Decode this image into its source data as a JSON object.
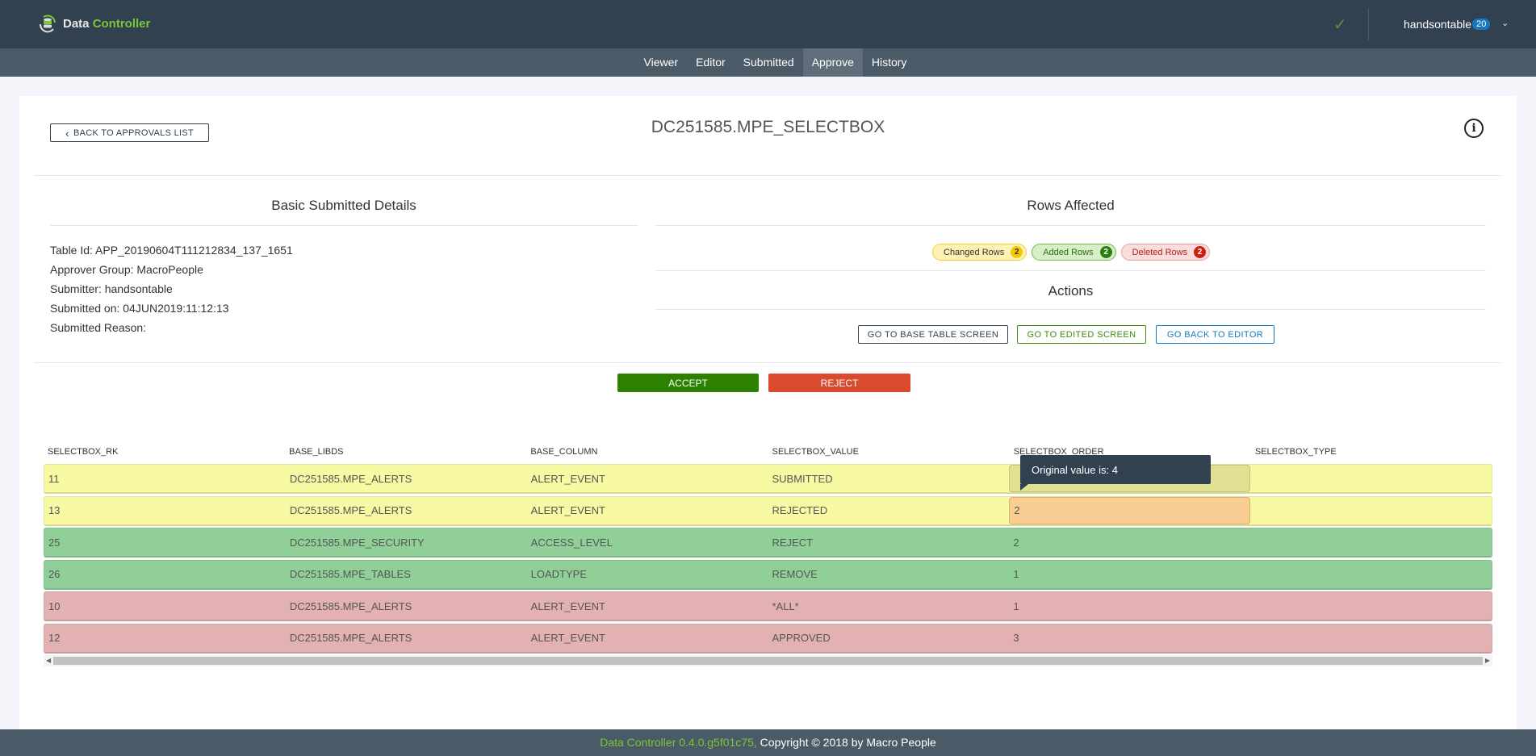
{
  "header": {
    "app_name_part1": "Data",
    "app_name_part2": "Controller",
    "status_icon": "check-icon",
    "user": "handsontable",
    "user_badge": "20"
  },
  "nav": {
    "items": [
      {
        "label": "Viewer",
        "active": false
      },
      {
        "label": "Editor",
        "active": false
      },
      {
        "label": "Submitted",
        "active": false
      },
      {
        "label": "Approve",
        "active": true
      },
      {
        "label": "History",
        "active": false
      }
    ]
  },
  "page": {
    "back_label": "BACK TO APPROVALS LIST",
    "title": "DC251585.MPE_SELECTBOX"
  },
  "details": {
    "title": "Basic Submitted Details",
    "table_id": "Table Id: APP_20190604T111212834_137_1651",
    "approver_group": "Approver Group: MacroPeople",
    "submitter": "Submitter: handsontable",
    "submitted_on": "Submitted on: 04JUN2019:11:12:13",
    "reason": "Submitted Reason:"
  },
  "rows_affected": {
    "title": "Rows Affected",
    "changed": {
      "label": "Changed Rows",
      "count": "2",
      "color": "#f5c800"
    },
    "added": {
      "label": "Added Rows",
      "count": "2",
      "color": "#2a7e14"
    },
    "deleted": {
      "label": "Deleted Rows",
      "count": "2",
      "color": "#cf1f10"
    }
  },
  "actions": {
    "title": "Actions",
    "base_table": "GO TO BASE TABLE SCREEN",
    "edited": "GO TO EDITED SCREEN",
    "back_editor": "GO BACK TO EDITOR",
    "accept": "ACCEPT",
    "reject": "REJECT"
  },
  "table": {
    "columns": [
      "SELECTBOX_RK",
      "BASE_LIBDS",
      "BASE_COLUMN",
      "SELECTBOX_VALUE",
      "SELECTBOX_ORDER",
      "SELECTBOX_TYPE"
    ],
    "rows": [
      {
        "status": "changed",
        "cells": [
          "11",
          "DC251585.MPE_ALERTS",
          "ALERT_EVENT",
          "SUBMITTED",
          "",
          ""
        ]
      },
      {
        "status": "changed",
        "cells": [
          "13",
          "DC251585.MPE_ALERTS",
          "ALERT_EVENT",
          "REJECTED",
          "2",
          ""
        ]
      },
      {
        "status": "added",
        "cells": [
          "25",
          "DC251585.MPE_SECURITY",
          "ACCESS_LEVEL",
          "REJECT",
          "2",
          ""
        ]
      },
      {
        "status": "added",
        "cells": [
          "26",
          "DC251585.MPE_TABLES",
          "LOADTYPE",
          "REMOVE",
          "1",
          ""
        ]
      },
      {
        "status": "deleted",
        "cells": [
          "10",
          "DC251585.MPE_ALERTS",
          "ALERT_EVENT",
          "*ALL*",
          "1",
          ""
        ]
      },
      {
        "status": "deleted",
        "cells": [
          "12",
          "DC251585.MPE_ALERTS",
          "ALERT_EVENT",
          "APPROVED",
          "3",
          ""
        ]
      }
    ],
    "tooltip": "Original value is: 4"
  },
  "footer": {
    "version": "Data Controller 0.4.0.g5f01c75,",
    "copyright": " Copyright © 2018 by Macro People"
  }
}
